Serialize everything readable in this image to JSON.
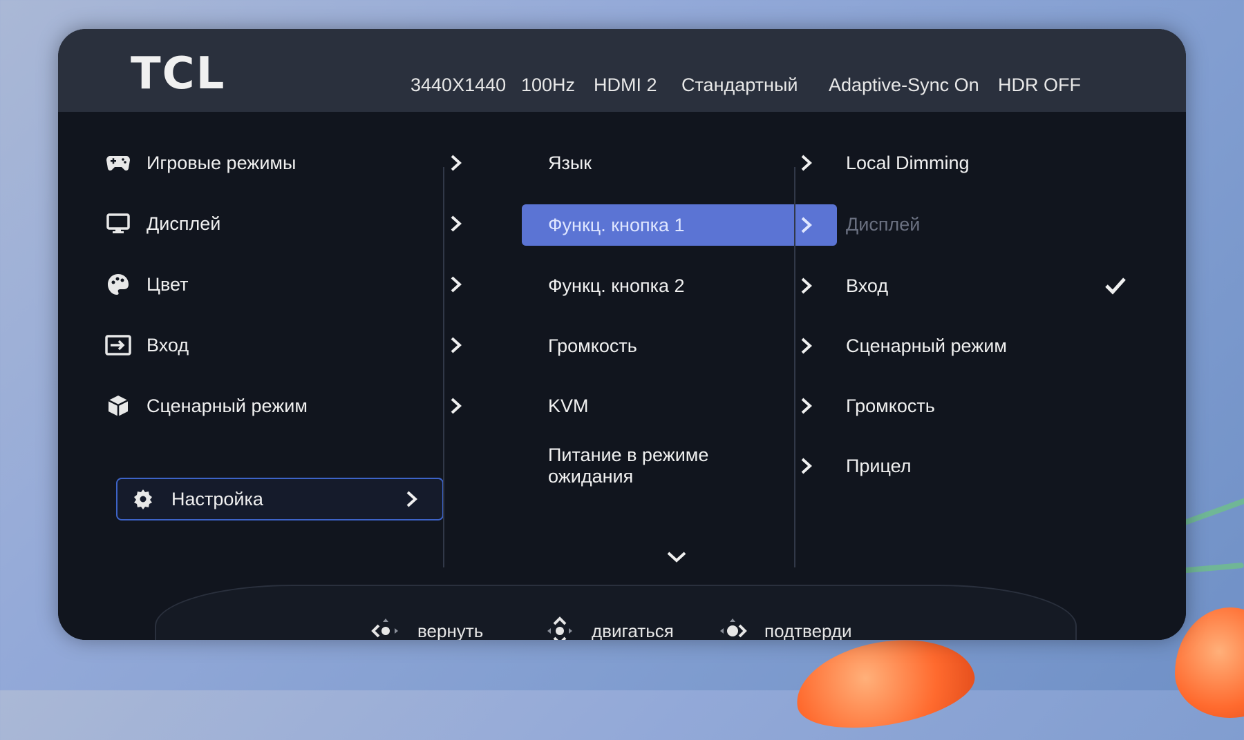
{
  "brand": {
    "logo_text": "TCL"
  },
  "status_bar": {
    "resolution": "3440X1440",
    "refresh": "100Hz",
    "input": "HDMI 2",
    "picture_mode": "Стандартный",
    "adaptive_sync": "Adaptive-Sync On",
    "hdr": "HDR OFF"
  },
  "main_menu": {
    "items": [
      {
        "label": "Игровые режимы",
        "icon": "gamepad-icon"
      },
      {
        "label": "Дисплей",
        "icon": "monitor-icon"
      },
      {
        "label": "Цвет",
        "icon": "palette-icon"
      },
      {
        "label": "Вход",
        "icon": "input-icon"
      },
      {
        "label": "Сценарный режим",
        "icon": "cube-icon"
      },
      {
        "label": "Настройка",
        "icon": "gear-icon"
      }
    ],
    "selected": "Настройка"
  },
  "settings_menu": {
    "items": [
      {
        "label": "Язык"
      },
      {
        "label": "Функц. кнопка 1"
      },
      {
        "label": "Функц. кнопка 2"
      },
      {
        "label": "Громкость"
      },
      {
        "label": "KVM"
      },
      {
        "label": "Питание в режиме ожидания"
      }
    ],
    "selected": "Функц. кнопка 1"
  },
  "options_menu": {
    "items": [
      {
        "label": "Local Dimming"
      },
      {
        "label": "Дисплей"
      },
      {
        "label": "Вход"
      },
      {
        "label": "Сценарный режим"
      },
      {
        "label": "Громкость"
      },
      {
        "label": "Прицел"
      }
    ],
    "disabled": "Дисплей",
    "checked": "Вход"
  },
  "footer": {
    "back": "вернуть",
    "move": "двигаться",
    "confirm": "подтверди"
  },
  "colors": {
    "accent": "#5b74d4",
    "outline": "#3d63c7",
    "panel": "#11151e",
    "topbar": "#2a303d"
  }
}
